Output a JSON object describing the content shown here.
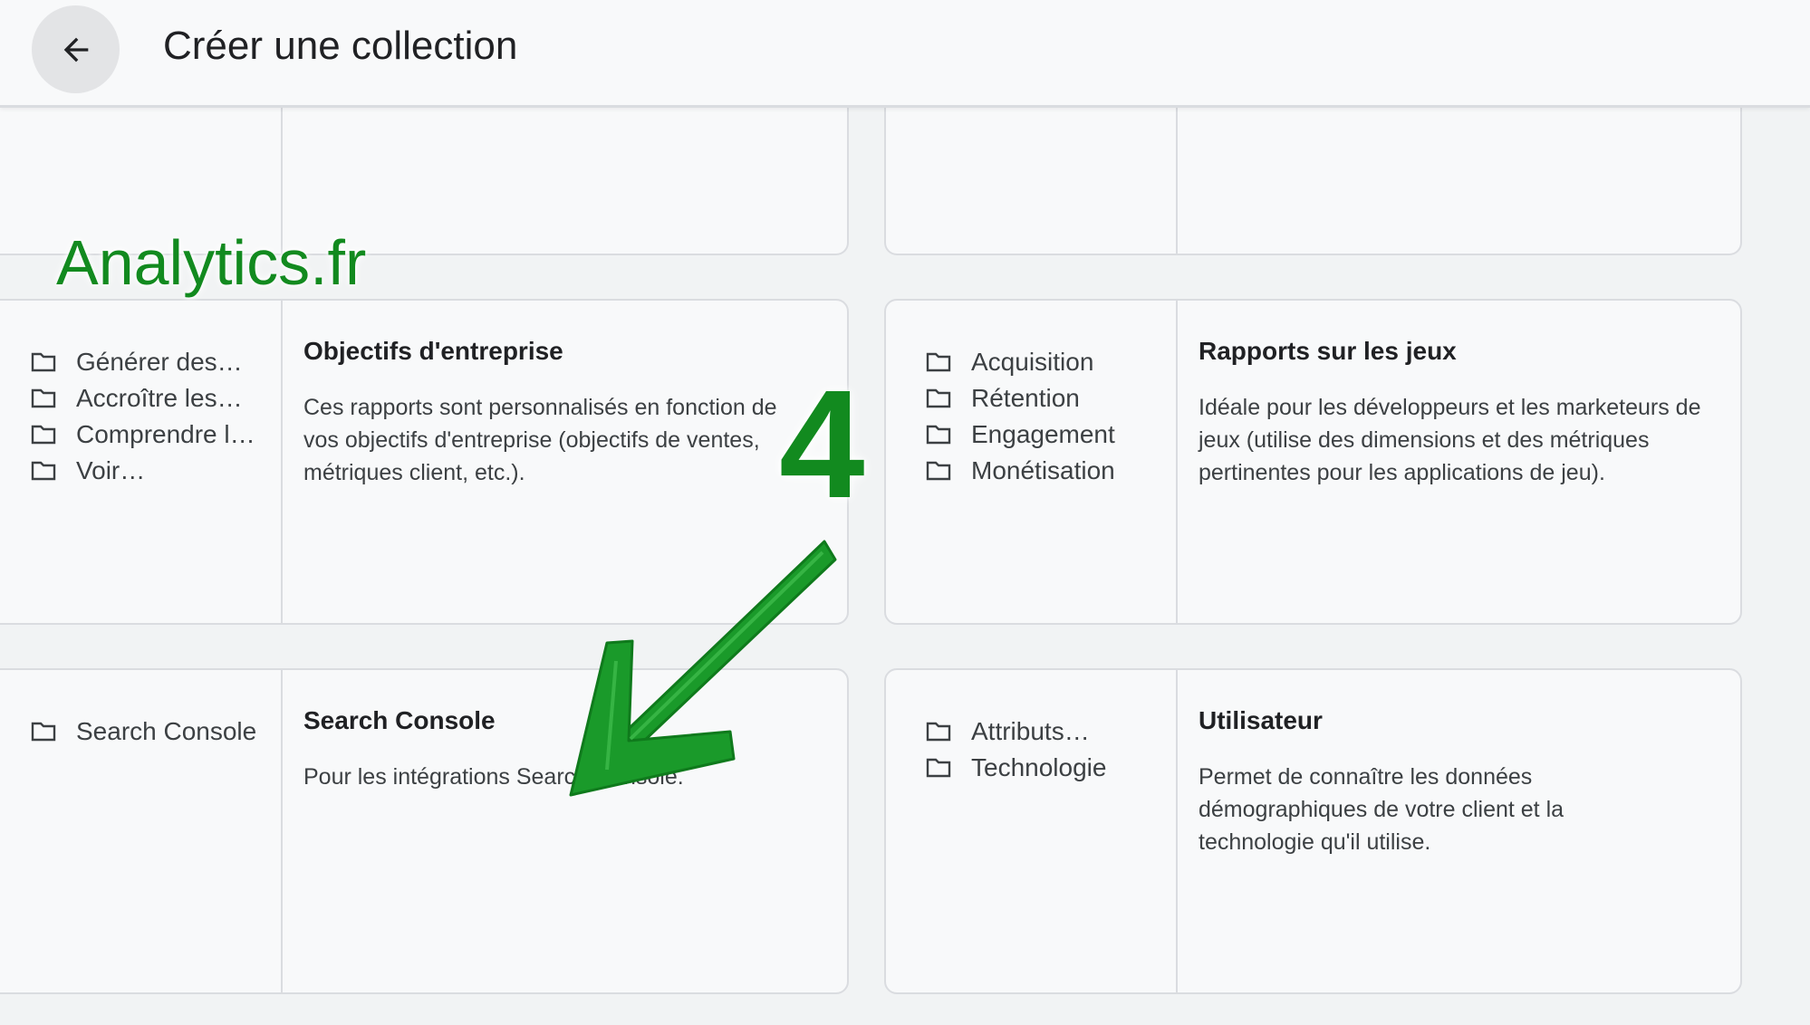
{
  "header": {
    "title": "Créer une collection",
    "back_icon": "arrow-back-icon"
  },
  "watermark": "Analytics.fr",
  "step_number": "4",
  "cards": {
    "objectifs": {
      "folders": [
        "Générer des…",
        "Accroître les…",
        "Comprendre l…",
        "Voir…"
      ],
      "title": "Objectifs d'entreprise",
      "description": "Ces rapports sont personnalisés en fonction de vos objectifs d'entreprise (objectifs de ventes, métriques client, etc.)."
    },
    "jeux": {
      "folders": [
        "Acquisition",
        "Rétention",
        "Engagement",
        "Monétisation"
      ],
      "title": "Rapports sur les jeux",
      "description": "Idéale pour les développeurs et les marketeurs de jeux (utilise des dimensions et des métriques pertinentes pour les applications de jeu)."
    },
    "search_console": {
      "folders": [
        "Search Console"
      ],
      "title": "Search Console",
      "description": "Pour les intégrations Search Console."
    },
    "utilisateur": {
      "folders": [
        "Attributs…",
        "Technologie"
      ],
      "title": "Utilisateur",
      "description": "Permet de connaître les données démographiques de votre client et la technologie qu'il utilise."
    }
  },
  "colors": {
    "accent_green": "#128a1f",
    "background": "#f1f3f4",
    "card": "#f8f9fa",
    "border": "#dadce0"
  }
}
